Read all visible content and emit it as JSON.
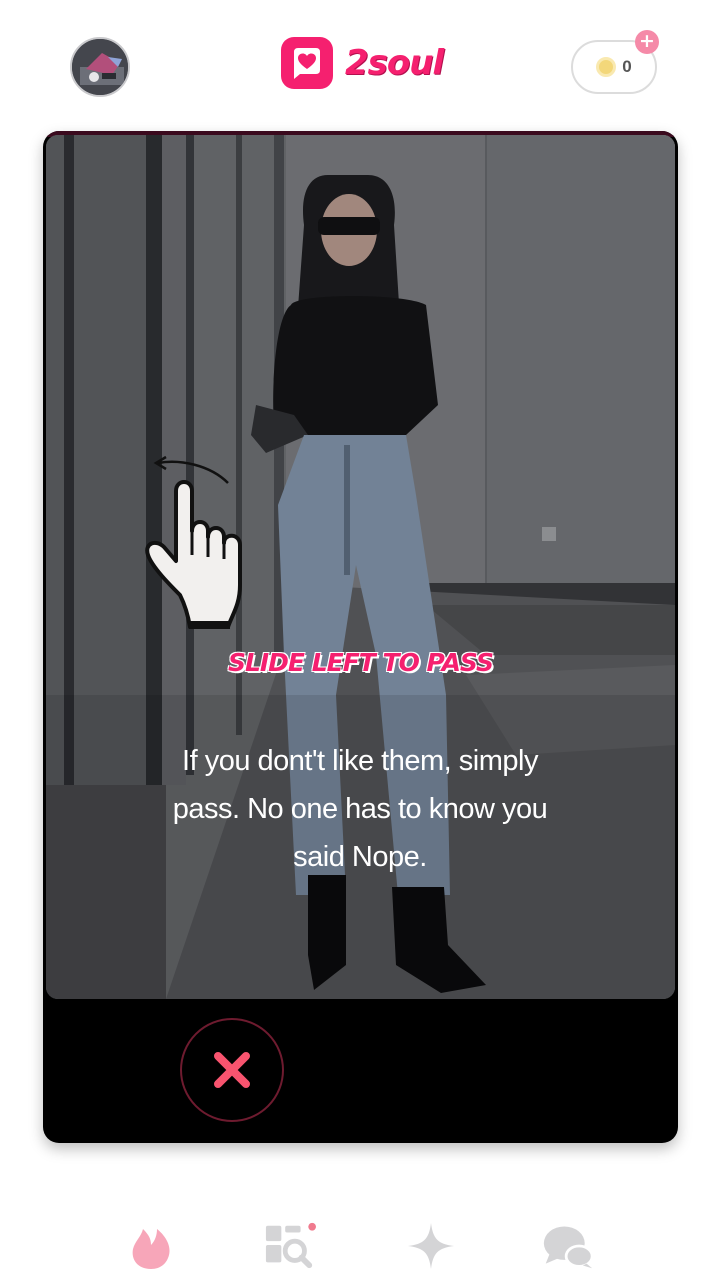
{
  "app": {
    "name": "2soul",
    "brand_color": "#f5206f"
  },
  "header": {
    "avatar_icon": "user-avatar",
    "logo_icon": "heart-chat-icon",
    "coins": {
      "count": "0",
      "icon": "coin-icon",
      "add_icon": "plus-icon",
      "add_label": "+"
    }
  },
  "card": {
    "gesture_icon": "swipe-left-hand-icon",
    "title": "SLIDE LEFT TO PASS",
    "message": "If you dont't like them, simply pass. No one has to know you said Nope.",
    "pass_button_icon": "close-x-icon"
  },
  "nav": {
    "items": [
      {
        "icon": "flame-icon",
        "active": true
      },
      {
        "icon": "discover-search-icon",
        "badge": true
      },
      {
        "icon": "sparkle-icon",
        "active": false
      },
      {
        "icon": "chat-bubbles-icon",
        "active": false
      }
    ]
  }
}
